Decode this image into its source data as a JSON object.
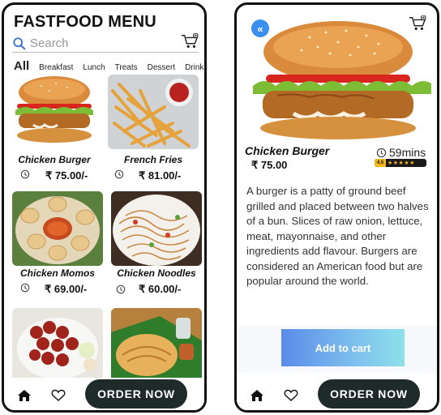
{
  "menu_screen": {
    "title": "FASTFOOD MENU",
    "search_placeholder": "Search",
    "categories": [
      "All",
      "Breakfast",
      "Lunch",
      "Treats",
      "Dessert",
      "Drinks"
    ],
    "items": [
      {
        "name": "Chicken Burger",
        "price": "₹ 75.00/-"
      },
      {
        "name": "French Fries",
        "price": "₹ 81.00/-"
      },
      {
        "name": "Chicken Momos",
        "price": "₹ 69.00/-"
      },
      {
        "name": "Chicken Noodles",
        "price": "₹ 60.00/-"
      }
    ],
    "order_label": "ORDER NOW"
  },
  "detail_screen": {
    "back_icon": "«",
    "name": "Chicken Burger",
    "price": "₹ 75.00",
    "time": "59mins",
    "rating": "4.5",
    "stars": "★★★★★",
    "description": "A burger is a patty of ground beef grilled and placed between two halves of a bun. Slices of raw onion, lettuce, meat, mayonnaise, and other ingredients add flavour. Burgers are considered an American food but are popular around the world.",
    "add_to_cart": "Add to cart",
    "order_label": "ORDER NOW"
  },
  "colors": {
    "accent_blue": "#3b8df0",
    "order_button": "#1f2a2a",
    "rating_gold": "#f3b81c"
  },
  "icons": [
    "cart-icon",
    "search-icon",
    "clock-icon",
    "home-icon",
    "heart-icon",
    "back-icon"
  ]
}
